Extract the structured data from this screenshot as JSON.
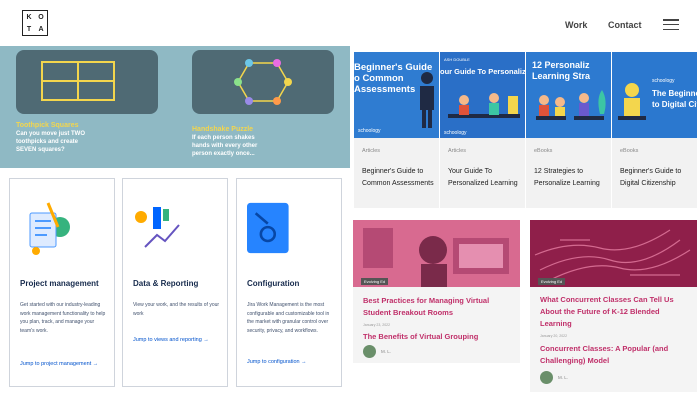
{
  "header": {
    "logo_letters": [
      "K",
      "O",
      "T",
      "A"
    ],
    "nav_work": "Work",
    "nav_contact": "Contact"
  },
  "puzzles": {
    "left_title": "Toothpick Squares",
    "left_text": [
      "Can you move just TWO",
      "toothpicks and create",
      "SEVEN squares?"
    ],
    "right_title": "Handshake Puzzle",
    "right_text": [
      "If each person shakes",
      "hands with every other",
      "person exactly once..."
    ]
  },
  "jira_cards": [
    {
      "title": "Project management",
      "desc": "Get started with our industry-leading work management functionality to help you plan, track, and manage your team's work.",
      "link": "Jump to project management →"
    },
    {
      "title": "Data & Reporting",
      "desc": "View your work, and the results of your work",
      "link": "Jump to views and reporting →"
    },
    {
      "title": "Configuration",
      "desc": "Jira Work Management is the most configurable and customizable tool in the market with granular control over security, privacy, and workflows.",
      "link": "Jump to configuration →"
    }
  ],
  "articles": [
    {
      "category": "Articles",
      "title": "Beginner's Guide to Common Assessments",
      "img_text": [
        "Beginner's Guide",
        "o Common",
        "Assessments"
      ],
      "brand": "schoology"
    },
    {
      "category": "Articles",
      "title": "Your Guide To Personalized Learning",
      "img_text": [
        "our Guide To Personalized Le"
      ],
      "brand": "schoology",
      "badge": "ASH DOUBLE"
    },
    {
      "category": "eBooks",
      "title": "12 Strategies to Personalize Learning",
      "img_text": [
        "12 Personaliz",
        "Learning Stra"
      ],
      "brand": "schoology"
    },
    {
      "category": "eBooks",
      "title": "Beginner's Guide to Digital Citizenship",
      "img_text": [
        "The Beginner's",
        "to Digital Citiz"
      ],
      "brand": "schoology"
    }
  ],
  "bottom_articles": [
    {
      "tag": "Evolving Ed",
      "title": "Best Practices for Managing Virtual Student Breakout Rooms",
      "date": "January 23, 2022",
      "subtitle": "The Benefits of Virtual Grouping",
      "author": "M. L."
    },
    {
      "tag": "Evolving Ed",
      "title": "What Concurrent Classes Can Tell Us About the Future of K-12 Blended Learning",
      "date": "January 20, 2022",
      "subtitle": "Concurrent Classes: A Popular (and Challenging) Model",
      "author": "M. L."
    }
  ],
  "colors": {
    "puzzle_bg": "#8fb9c4",
    "puzzle_card": "#4f6a74",
    "puzzle_title": "#f3d64d",
    "article_blue": "#2f7cd1",
    "pink_title": "#c0306a",
    "jira_blue": "#0052cc"
  }
}
